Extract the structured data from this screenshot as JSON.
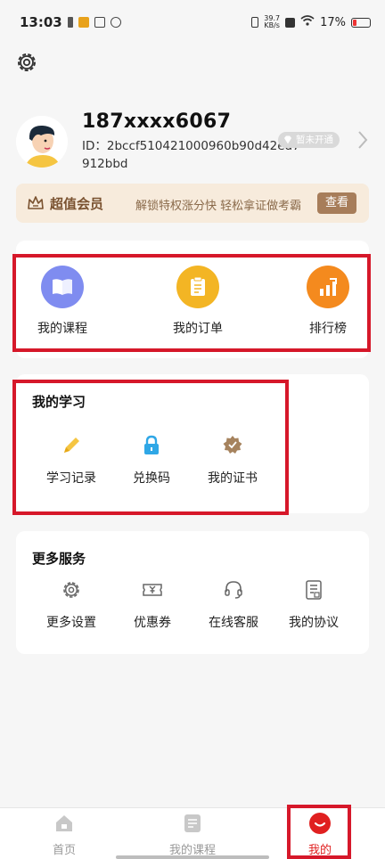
{
  "status_bar": {
    "time": "13:03",
    "net_speed_value": "39.7",
    "net_speed_unit": "KB/s",
    "battery": "17%"
  },
  "header": {
    "settings_icon": "gear-icon"
  },
  "profile": {
    "phone": "187xxxx6067",
    "uid_text": "ID：2bccf510421000960b90d42ed7912bbd",
    "vip_badge": "暂未开通"
  },
  "member_banner": {
    "title": "超值会员",
    "desc": "解锁特权涨分快 轻松拿证做考霸",
    "button": "查看",
    "colors": {
      "background": "#f7ebdc",
      "button": "#a77d5a"
    }
  },
  "top_actions": [
    {
      "label": "我的课程",
      "icon": "book-icon",
      "color": "#7f8cf0"
    },
    {
      "label": "我的订单",
      "icon": "clipboard-icon",
      "color": "#f3b524"
    },
    {
      "label": "排行榜",
      "icon": "bar-chart-icon",
      "color": "#f48a1e"
    }
  ],
  "study": {
    "title": "我的学习",
    "items": [
      {
        "label": "学习记录",
        "icon": "pencil-icon"
      },
      {
        "label": "兑换码",
        "icon": "lock-icon"
      },
      {
        "label": "我的证书",
        "icon": "certificate-icon"
      }
    ]
  },
  "services": {
    "title": "更多服务",
    "items": [
      {
        "label": "更多设置",
        "icon": "gear-icon"
      },
      {
        "label": "优惠券",
        "icon": "coupon-icon"
      },
      {
        "label": "在线客服",
        "icon": "headset-icon"
      },
      {
        "label": "我的协议",
        "icon": "document-icon"
      }
    ]
  },
  "bottom_nav": {
    "items": [
      {
        "label": "首页",
        "icon": "home-icon"
      },
      {
        "label": "我的课程",
        "icon": "course-icon"
      },
      {
        "label": "我的",
        "icon": "smile-icon"
      }
    ],
    "active": "我的",
    "accent": "#e02020"
  },
  "annotation_color": "#d6182a"
}
